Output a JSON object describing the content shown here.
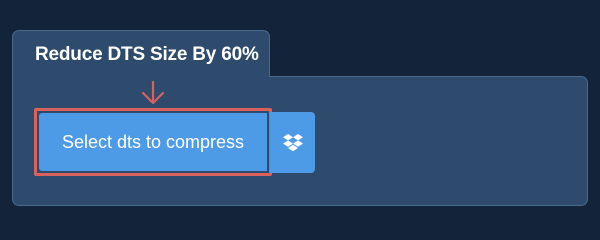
{
  "panel": {
    "title": "Reduce DTS Size By 60%"
  },
  "upload": {
    "select_label": "Select dts to compress",
    "dropbox_icon": "dropbox-icon",
    "pointer_icon": "down-arrow-icon"
  },
  "colors": {
    "background": "#13243a",
    "panel": "#2e4b6d",
    "button": "#4d9be6",
    "highlight": "#d9625d"
  }
}
